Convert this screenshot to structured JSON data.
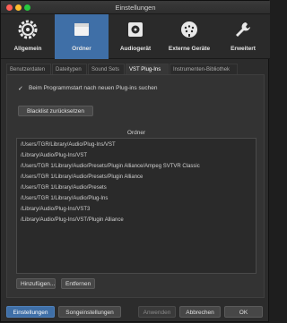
{
  "window": {
    "title": "Einstellungen"
  },
  "toolbar": {
    "items": [
      {
        "label": "Allgemein",
        "icon": "gear-icon"
      },
      {
        "label": "Ordner",
        "icon": "folder-icon"
      },
      {
        "label": "Audiogerät",
        "icon": "audio-device-icon"
      },
      {
        "label": "Externe Geräte",
        "icon": "midi-plug-icon"
      },
      {
        "label": "Erweitert",
        "icon": "wrench-icon"
      }
    ],
    "active_index": 1
  },
  "tabs": {
    "items": [
      {
        "label": "Benutzerdaten"
      },
      {
        "label": "Dateitypen"
      },
      {
        "label": "Sound Sets"
      },
      {
        "label": "VST Plug-Ins"
      },
      {
        "label": "Instrumenten-Bibliothek"
      }
    ],
    "active_index": 3
  },
  "vst": {
    "scan_on_start_label": "Beim Programmstart nach neuen Plug-ins suchen",
    "scan_on_start_checked": true,
    "reset_blacklist_label": "Blacklist zurücksetzen",
    "list_header": "Ordner",
    "folders": [
      "/Users/TGR/Library/Audio/Plug-Ins/VST",
      "/Library/Audio/Plug-Ins/VST",
      "/Users/TGR 1/Library/Audio/Presets/Plugin Alliance/Ampeg SVTVR Classic",
      "/Users/TGR 1/Library/Audio/Presets/Plugin Alliance",
      "/Users/TGR 1/Library/Audio/Presets",
      "/Users/TGR 1/Library/Audio/Plug-Ins",
      "/Library/Audio/Plug-Ins/VST3",
      "/Library/Audio/Plug-Ins/VST/Plugin Alliance"
    ],
    "add_label": "Hinzufügen...",
    "remove_label": "Entfernen"
  },
  "footer": {
    "settings_label": "Einstellungen",
    "song_settings_label": "Songeinstellungen",
    "apply_label": "Anwenden",
    "cancel_label": "Abbrechen",
    "ok_label": "OK"
  },
  "colors": {
    "accent": "#3f6fa7",
    "background": "#2c2c2c"
  }
}
